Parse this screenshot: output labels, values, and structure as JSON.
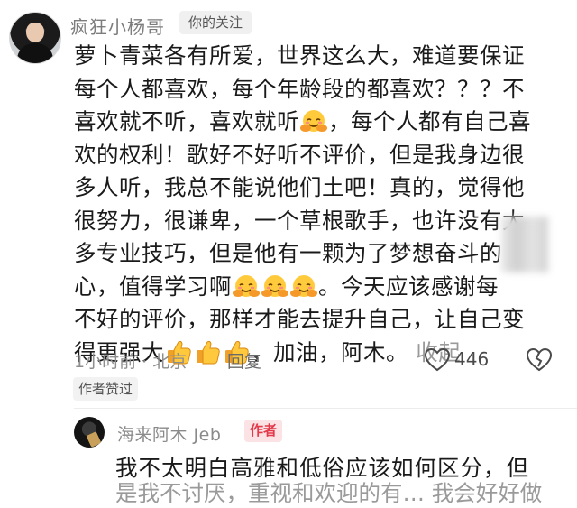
{
  "comment": {
    "username": "疯狂小杨哥",
    "follow_badge": "你的关注",
    "lines": [
      "萝卜青菜各有所爱，世界这么大，难道要保证",
      "每个人都喜欢，每个年龄段的都喜欢？？？不",
      [
        "喜欢就不听，喜欢就听",
        "，每个人都有自己喜"
      ],
      "欢的权利！歌好不好听不评价，但是我身边很",
      "多人听，我总不能说他们土吧！真的，觉得他",
      "很努力，很谦卑，一个草根歌手，也许没有太",
      "多专业技巧，但是他有一颗为了梦想奋斗的",
      [
        "心，值得学习啊",
        "。今天应该感谢每"
      ],
      "不好的评价，那样才能去提升自己，让自己变",
      [
        "得更强大",
        "，加油，阿木。"
      ]
    ],
    "collapse_label": "收起",
    "time_location": "1小时前 · 北京",
    "reply_label": "回复",
    "like_count": "446",
    "author_liked_badge": "作者赞过",
    "emojis": {
      "hug": "hug-emoji",
      "thumbs_up": "thumbs-up-emoji"
    }
  },
  "reply": {
    "username": "海来阿木 Jeb",
    "author_badge": "作者",
    "text": "我不太明白高雅和低俗应该如何区分，但",
    "text_cut": "是我不讨厌，重视和欢迎的有… 我会好好做"
  },
  "colors": {
    "muted": "#8e8e8e",
    "author_badge_bg": "#fbe2e5",
    "author_badge_fg": "#e33a4b"
  }
}
